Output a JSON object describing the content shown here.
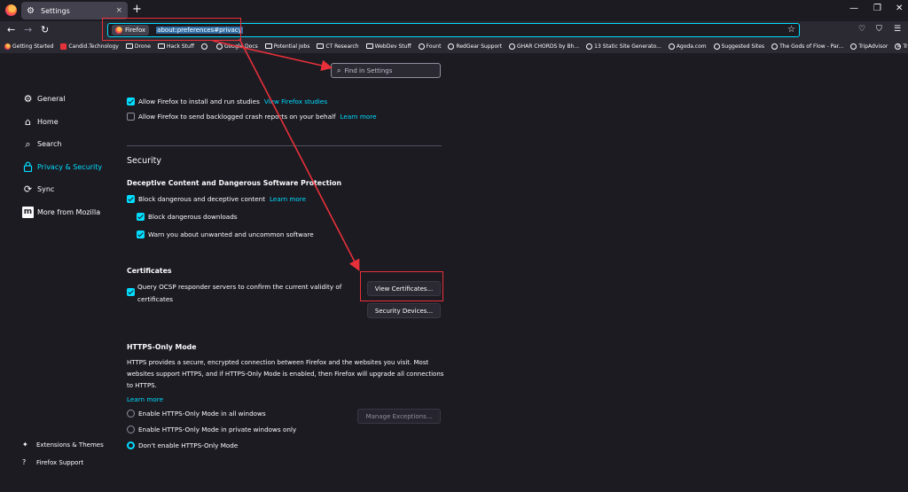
{
  "tab": {
    "title": "Settings",
    "close": "×",
    "new": "+"
  },
  "window": {
    "minimize": "—",
    "restore": "❐",
    "close": "✕"
  },
  "nav": {
    "back": "←",
    "forward": "→",
    "reload": "↻"
  },
  "urlbar": {
    "identity_label": "Firefox",
    "url": "about:preferences#privacy",
    "bookmark_star": "☆"
  },
  "bookmarks": [
    {
      "label": "Getting Started",
      "icon": "firefox"
    },
    {
      "label": "Candid.Technology",
      "icon": "site"
    },
    {
      "label": "Drone",
      "icon": "folder"
    },
    {
      "label": "Hack Stuff",
      "icon": "folder"
    },
    {
      "label": "",
      "icon": "globe"
    },
    {
      "label": "Google Docs",
      "icon": "globe"
    },
    {
      "label": "Potential Jobs",
      "icon": "folder"
    },
    {
      "label": "CT Research",
      "icon": "folder"
    },
    {
      "label": "WebDev Stuff",
      "icon": "folder"
    },
    {
      "label": "Fount",
      "icon": "globe"
    },
    {
      "label": "RedGear Support",
      "icon": "globe"
    },
    {
      "label": "GHAR CHORDS by Bh...",
      "icon": "globe"
    },
    {
      "label": "13 Static Site Generato...",
      "icon": "globe"
    },
    {
      "label": "Agoda.com",
      "icon": "globe"
    },
    {
      "label": "Suggested Sites",
      "icon": "globe"
    },
    {
      "label": "The Gods of Flow - Par...",
      "icon": "globe"
    },
    {
      "label": "TripAdvisor",
      "icon": "globe"
    },
    {
      "label": "TripAdvisor",
      "icon": "globe"
    }
  ],
  "bookmarks_more": "»",
  "search": {
    "placeholder": "Find in Settings"
  },
  "sidebar": {
    "items": [
      {
        "label": "General",
        "icon": "gear-icon",
        "glyph": "⚙"
      },
      {
        "label": "Home",
        "icon": "home-icon",
        "glyph": "⌂"
      },
      {
        "label": "Search",
        "icon": "search-icon",
        "glyph": "⌕"
      },
      {
        "label": "Privacy & Security",
        "icon": "lock-icon",
        "glyph": "🔒"
      },
      {
        "label": "Sync",
        "icon": "sync-icon",
        "glyph": "⟳"
      },
      {
        "label": "More from Mozilla",
        "icon": "mozilla-icon",
        "glyph": "m"
      }
    ],
    "footer": [
      {
        "label": "Extensions & Themes",
        "icon": "puzzle-icon",
        "glyph": "✦"
      },
      {
        "label": "Firefox Support",
        "icon": "help-icon",
        "glyph": "?"
      }
    ]
  },
  "data_collection": {
    "studies_label": "Allow Firefox to install and run studies",
    "studies_link": "View Firefox studies",
    "crash_label": "Allow Firefox to send backlogged crash reports on your behalf",
    "crash_link": "Learn more"
  },
  "security": {
    "title": "Security",
    "deceptive_title": "Deceptive Content and Dangerous Software Protection",
    "block_deceptive": "Block dangerous and deceptive content",
    "block_deceptive_link": "Learn more",
    "block_downloads": "Block dangerous downloads",
    "warn_unwanted": "Warn you about unwanted and uncommon software"
  },
  "certificates": {
    "title": "Certificates",
    "ocsp_line1": "Query OCSP responder servers to confirm the current validity of",
    "ocsp_line2": "certificates",
    "view_button": "View Certificates...",
    "devices_button": "Security Devices..."
  },
  "https_only": {
    "title": "HTTPS-Only Mode",
    "description": "HTTPS provides a secure, encrypted connection between Firefox and the websites you visit. Most websites support HTTPS, and if HTTPS-Only Mode is enabled, then Firefox will upgrade all connections to HTTPS.",
    "learn_more": "Learn more",
    "option_all": "Enable HTTPS-Only Mode in all windows",
    "option_private": "Enable HTTPS-Only Mode in private windows only",
    "option_off": "Don't enable HTTPS-Only Mode",
    "exceptions_button": "Manage Exceptions..."
  },
  "colors": {
    "accent": "#00ddff",
    "annotation": "#e8303a",
    "background": "#1c1b22"
  }
}
